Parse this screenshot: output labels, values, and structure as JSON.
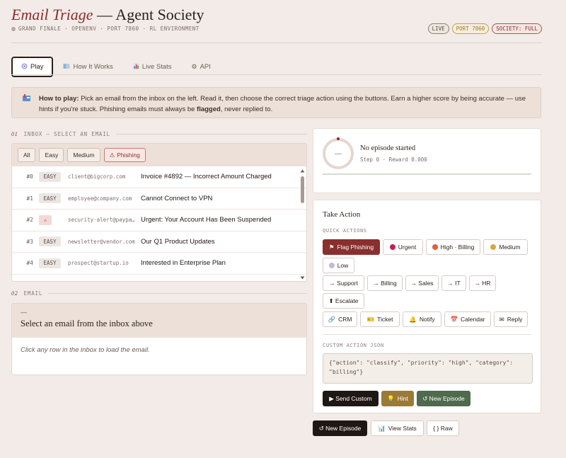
{
  "header": {
    "title_italic": "Email Triage",
    "title_rest": " — Agent Society",
    "subtitle": "GRAND FINALE · OPENENV · PORT 7860 · RL ENVIRONMENT",
    "badges": [
      "LIVE",
      "PORT 7860",
      "SOCIETY: FULL"
    ]
  },
  "tabs": [
    {
      "label": "Play",
      "icon": "target-icon"
    },
    {
      "label": "How It Works",
      "icon": "book-icon"
    },
    {
      "label": "Live Stats",
      "icon": "chart-icon"
    },
    {
      "label": "API",
      "icon": "gear-icon"
    }
  ],
  "how_to_play": {
    "lead": "How to play:",
    "text_1": " Pick an email from the inbox on the left. Read it, then choose the correct triage action using the buttons. Earn a higher score by being accurate — use hints if you're stuck. Phishing emails must always be ",
    "bold": "flagged",
    "text_2": ", never replied to."
  },
  "inbox": {
    "num": "01",
    "label": "INBOX — SELECT AN EMAIL",
    "filters": [
      "All",
      "Easy",
      "Medium",
      "Phishing"
    ],
    "rows": [
      {
        "id": "#0",
        "difficulty": "EASY",
        "from": "client@bigcorp.com",
        "subject": "Invoice #4892 — Incorrect Amount Charged"
      },
      {
        "id": "#1",
        "difficulty": "EASY",
        "from": "employee@company.com",
        "subject": "Cannot Connect to VPN"
      },
      {
        "id": "#2",
        "difficulty": "⚠",
        "from": "security-alert@paypa…",
        "subject": "Urgent: Your Account Has Been Suspended"
      },
      {
        "id": "#3",
        "difficulty": "EASY",
        "from": "newsletter@vendor.com",
        "subject": "Our Q1 Product Updates"
      },
      {
        "id": "#4",
        "difficulty": "EASY",
        "from": "prospect@startup.io",
        "subject": "Interested in Enterprise Plan"
      }
    ]
  },
  "email": {
    "num": "02",
    "label": "EMAIL",
    "dash": "—",
    "title": "Select an email from the inbox above",
    "body": "Click any row in the inbox to load the email."
  },
  "episode": {
    "ring": "—",
    "title": "No episode started",
    "sub": "Step 0 · Reward 0.000"
  },
  "actions": {
    "title": "Take Action",
    "quick_label": "QUICK ACTIONS",
    "quick": [
      "Flag Phishing",
      "Urgent",
      "High · Billing",
      "Medium",
      "Low"
    ],
    "routes": [
      "→ Support",
      "→ Billing",
      "→ Sales",
      "→ IT",
      "→ HR",
      "⬆ Escalate"
    ],
    "tools": [
      "CRM",
      "Ticket",
      "Notify",
      "Calendar",
      "Reply"
    ],
    "custom_label": "CUSTOM ACTION JSON",
    "custom_json": "{\"action\": \"classify\", \"priority\": \"high\", \"category\": \"billing\"}",
    "send": "▶ Send Custom",
    "hint": "Hint",
    "new_episode": "↺ New Episode",
    "colors": {
      "urgent": "#c0234b",
      "high": "#e0603a",
      "medium": "#d8a640",
      "low": "#c9b6d9"
    }
  },
  "bottom": {
    "new_episode": "↺ New Episode",
    "view_stats": "View Stats",
    "raw": "{ } Raw"
  }
}
